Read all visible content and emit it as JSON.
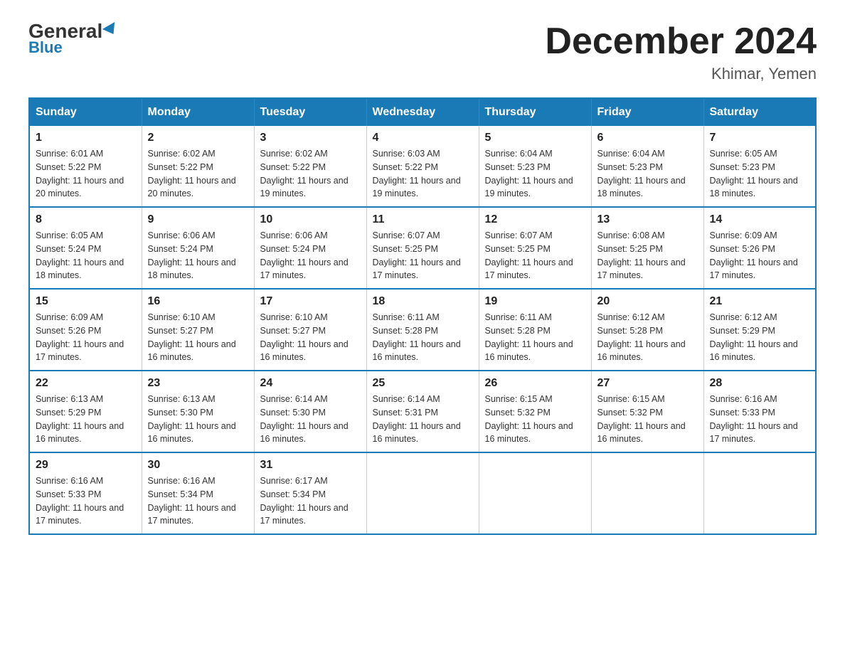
{
  "header": {
    "logo_general": "General",
    "logo_blue": "Blue",
    "month_title": "December 2024",
    "location": "Khimar, Yemen"
  },
  "days_of_week": [
    "Sunday",
    "Monday",
    "Tuesday",
    "Wednesday",
    "Thursday",
    "Friday",
    "Saturday"
  ],
  "weeks": [
    [
      {
        "day": "1",
        "sunrise": "6:01 AM",
        "sunset": "5:22 PM",
        "daylight": "11 hours and 20 minutes."
      },
      {
        "day": "2",
        "sunrise": "6:02 AM",
        "sunset": "5:22 PM",
        "daylight": "11 hours and 20 minutes."
      },
      {
        "day": "3",
        "sunrise": "6:02 AM",
        "sunset": "5:22 PM",
        "daylight": "11 hours and 19 minutes."
      },
      {
        "day": "4",
        "sunrise": "6:03 AM",
        "sunset": "5:22 PM",
        "daylight": "11 hours and 19 minutes."
      },
      {
        "day": "5",
        "sunrise": "6:04 AM",
        "sunset": "5:23 PM",
        "daylight": "11 hours and 19 minutes."
      },
      {
        "day": "6",
        "sunrise": "6:04 AM",
        "sunset": "5:23 PM",
        "daylight": "11 hours and 18 minutes."
      },
      {
        "day": "7",
        "sunrise": "6:05 AM",
        "sunset": "5:23 PM",
        "daylight": "11 hours and 18 minutes."
      }
    ],
    [
      {
        "day": "8",
        "sunrise": "6:05 AM",
        "sunset": "5:24 PM",
        "daylight": "11 hours and 18 minutes."
      },
      {
        "day": "9",
        "sunrise": "6:06 AM",
        "sunset": "5:24 PM",
        "daylight": "11 hours and 18 minutes."
      },
      {
        "day": "10",
        "sunrise": "6:06 AM",
        "sunset": "5:24 PM",
        "daylight": "11 hours and 17 minutes."
      },
      {
        "day": "11",
        "sunrise": "6:07 AM",
        "sunset": "5:25 PM",
        "daylight": "11 hours and 17 minutes."
      },
      {
        "day": "12",
        "sunrise": "6:07 AM",
        "sunset": "5:25 PM",
        "daylight": "11 hours and 17 minutes."
      },
      {
        "day": "13",
        "sunrise": "6:08 AM",
        "sunset": "5:25 PM",
        "daylight": "11 hours and 17 minutes."
      },
      {
        "day": "14",
        "sunrise": "6:09 AM",
        "sunset": "5:26 PM",
        "daylight": "11 hours and 17 minutes."
      }
    ],
    [
      {
        "day": "15",
        "sunrise": "6:09 AM",
        "sunset": "5:26 PM",
        "daylight": "11 hours and 17 minutes."
      },
      {
        "day": "16",
        "sunrise": "6:10 AM",
        "sunset": "5:27 PM",
        "daylight": "11 hours and 16 minutes."
      },
      {
        "day": "17",
        "sunrise": "6:10 AM",
        "sunset": "5:27 PM",
        "daylight": "11 hours and 16 minutes."
      },
      {
        "day": "18",
        "sunrise": "6:11 AM",
        "sunset": "5:28 PM",
        "daylight": "11 hours and 16 minutes."
      },
      {
        "day": "19",
        "sunrise": "6:11 AM",
        "sunset": "5:28 PM",
        "daylight": "11 hours and 16 minutes."
      },
      {
        "day": "20",
        "sunrise": "6:12 AM",
        "sunset": "5:28 PM",
        "daylight": "11 hours and 16 minutes."
      },
      {
        "day": "21",
        "sunrise": "6:12 AM",
        "sunset": "5:29 PM",
        "daylight": "11 hours and 16 minutes."
      }
    ],
    [
      {
        "day": "22",
        "sunrise": "6:13 AM",
        "sunset": "5:29 PM",
        "daylight": "11 hours and 16 minutes."
      },
      {
        "day": "23",
        "sunrise": "6:13 AM",
        "sunset": "5:30 PM",
        "daylight": "11 hours and 16 minutes."
      },
      {
        "day": "24",
        "sunrise": "6:14 AM",
        "sunset": "5:30 PM",
        "daylight": "11 hours and 16 minutes."
      },
      {
        "day": "25",
        "sunrise": "6:14 AM",
        "sunset": "5:31 PM",
        "daylight": "11 hours and 16 minutes."
      },
      {
        "day": "26",
        "sunrise": "6:15 AM",
        "sunset": "5:32 PM",
        "daylight": "11 hours and 16 minutes."
      },
      {
        "day": "27",
        "sunrise": "6:15 AM",
        "sunset": "5:32 PM",
        "daylight": "11 hours and 16 minutes."
      },
      {
        "day": "28",
        "sunrise": "6:16 AM",
        "sunset": "5:33 PM",
        "daylight": "11 hours and 17 minutes."
      }
    ],
    [
      {
        "day": "29",
        "sunrise": "6:16 AM",
        "sunset": "5:33 PM",
        "daylight": "11 hours and 17 minutes."
      },
      {
        "day": "30",
        "sunrise": "6:16 AM",
        "sunset": "5:34 PM",
        "daylight": "11 hours and 17 minutes."
      },
      {
        "day": "31",
        "sunrise": "6:17 AM",
        "sunset": "5:34 PM",
        "daylight": "11 hours and 17 minutes."
      },
      null,
      null,
      null,
      null
    ]
  ]
}
